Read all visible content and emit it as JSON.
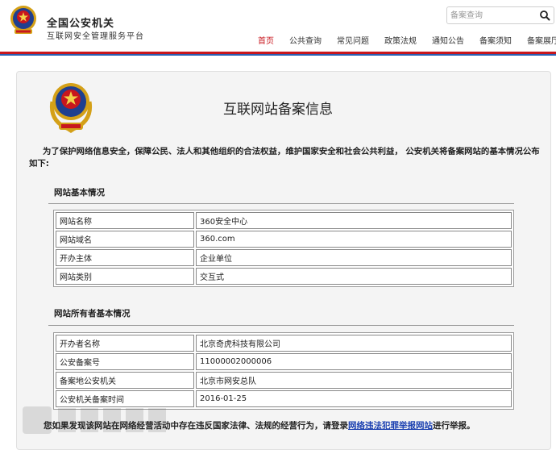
{
  "header": {
    "title": "全国公安机关",
    "subtitle": "互联网安全管理服务平台",
    "search_placeholder": "备案查询",
    "nav": [
      "首页",
      "公共查询",
      "常见问题",
      "政策法规",
      "通知公告",
      "备案须知",
      "备案展厅"
    ],
    "active_nav": "首页",
    "colors": {
      "accent_red": "#c8161d",
      "accent_blue": "#2b5fb3"
    }
  },
  "main": {
    "title": "互联网站备案信息",
    "intro": "为了保护网络信息安全，保障公民、法人和其他组织的合法权益，维护国家安全和社会公共利益， 公安机关将备案网站的基本情况公布如下:",
    "site_section": {
      "title": "网站基本情况",
      "rows": [
        [
          "网站名称",
          "360安全中心"
        ],
        [
          "网站域名",
          "360.com"
        ],
        [
          "开办主体",
          "企业单位"
        ],
        [
          "网站类别",
          "交互式"
        ]
      ]
    },
    "owner_section": {
      "title": "网站所有者基本情况",
      "rows": [
        [
          "开办者名称",
          "北京奇虎科技有限公司"
        ],
        [
          "公安备案号",
          "11000002000006"
        ],
        [
          "备案地公安机关",
          "北京市网安总队"
        ],
        [
          "公安机关备案时间",
          "2016-01-25"
        ]
      ]
    },
    "footer": {
      "prefix": "您如果发现该网站在网络经营活动中存在违反国家法律、法规的经营行为，请登录",
      "link": "网络违法犯罪举报网站",
      "suffix": "进行举报。"
    }
  },
  "icons": [
    "police-emblem-icon",
    "search-icon"
  ]
}
